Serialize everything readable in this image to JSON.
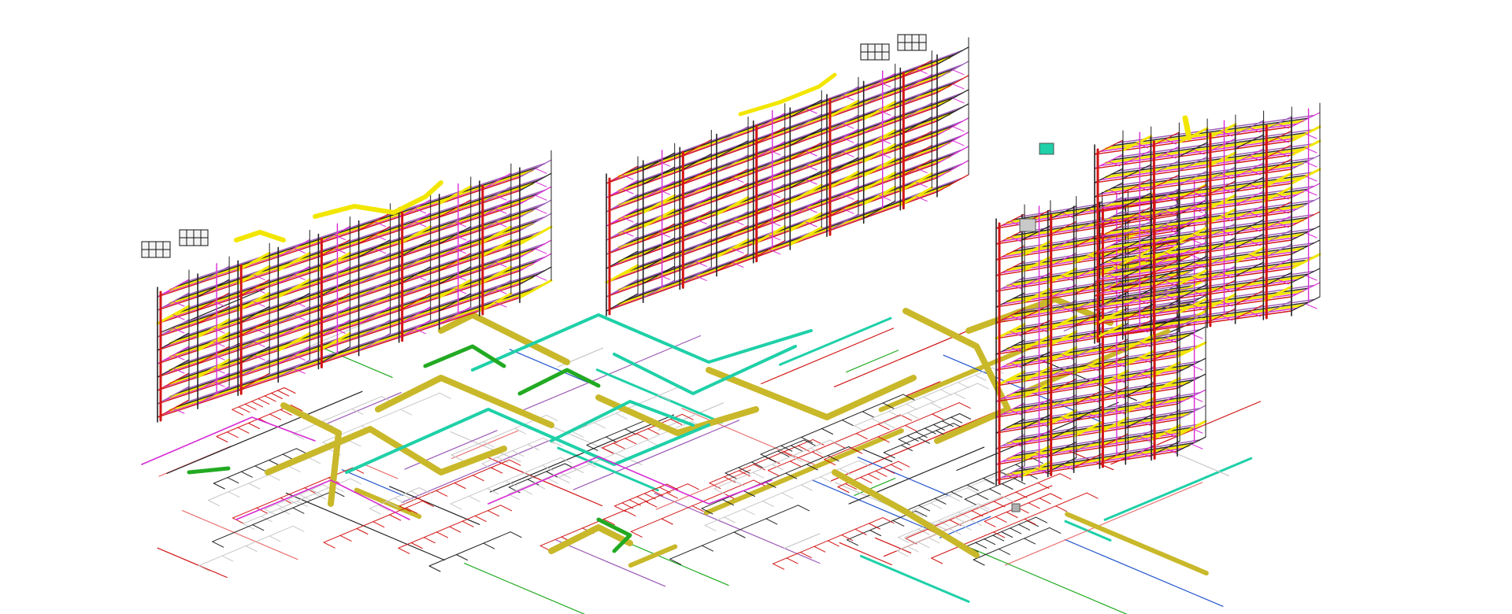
{
  "view": {
    "type": "isometric-3d-mep-model",
    "background": "#ffffff",
    "disciplines": [
      {
        "id": "structure",
        "color": "#222222"
      },
      {
        "id": "sanitary",
        "color": "#c8c8c8"
      },
      {
        "id": "fire-protection",
        "color": "#d21414"
      },
      {
        "id": "mechanical-duct",
        "color": "#c9b82a"
      },
      {
        "id": "supply-duct",
        "color": "#f2e600"
      },
      {
        "id": "domestic-water",
        "color": "#d72bd4"
      },
      {
        "id": "return-air",
        "color": "#9b59b6"
      },
      {
        "id": "chilled-water",
        "color": "#1fd0a8"
      },
      {
        "id": "heating-water",
        "color": "#22aa22"
      },
      {
        "id": "storm-drain",
        "color": "#2255cc"
      },
      {
        "id": "gas",
        "color": "#e87070"
      }
    ],
    "equipment_icons": [
      "rooftop-unit-icon",
      "chiller-icon",
      "pump-icon"
    ]
  }
}
